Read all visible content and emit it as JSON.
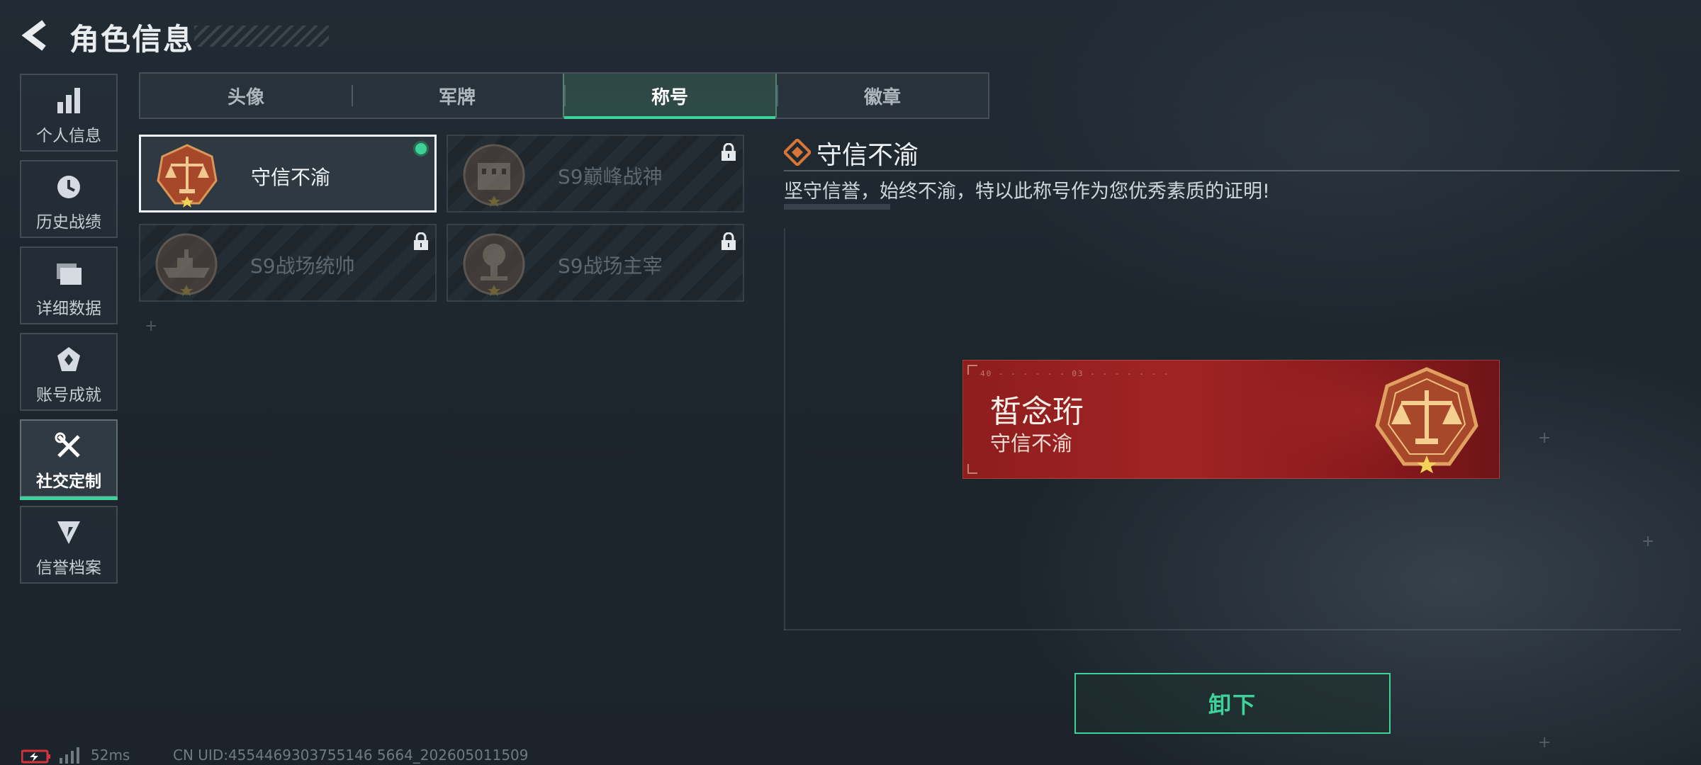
{
  "header": {
    "title": "角色信息",
    "back_icon": "back-arrow-icon"
  },
  "sidebar": {
    "items": [
      {
        "label": "个人信息",
        "icon": "bar-chart-icon"
      },
      {
        "label": "历史战绩",
        "icon": "history-icon"
      },
      {
        "label": "详细数据",
        "icon": "folder-icon"
      },
      {
        "label": "账号成就",
        "icon": "achievement-icon"
      },
      {
        "label": "社交定制",
        "icon": "tools-icon",
        "active": true
      },
      {
        "label": "信誉档案",
        "icon": "reputation-icon"
      }
    ]
  },
  "tabs": [
    {
      "label": "头像"
    },
    {
      "label": "军牌"
    },
    {
      "label": "称号",
      "active": true
    },
    {
      "label": "徽章"
    }
  ],
  "titles": [
    {
      "name": "守信不渝",
      "state": "equipped",
      "icon": "scales-medal-icon"
    },
    {
      "name": "S9巅峰战神",
      "state": "locked",
      "icon": "building-medal-icon"
    },
    {
      "name": "S9战场统帅",
      "state": "locked",
      "icon": "ship-medal-icon"
    },
    {
      "name": "S9战场主宰",
      "state": "locked",
      "icon": "explosion-medal-icon"
    }
  ],
  "detail": {
    "title": "守信不渝",
    "description": "坚守信誉，始终不渝，特以此称号作为您优秀素质的证明!"
  },
  "nameplate": {
    "player_name": "皙念珩",
    "title": "守信不渝"
  },
  "actions": {
    "unequip_label": "卸下"
  },
  "status": {
    "ping": "52ms",
    "uid": "CN UID:4554469303755146 5664_202605011509"
  },
  "colors": {
    "accent_green": "#3ed29a",
    "nameplate_red": "#a12424",
    "medal_orange": "#c0652a"
  }
}
